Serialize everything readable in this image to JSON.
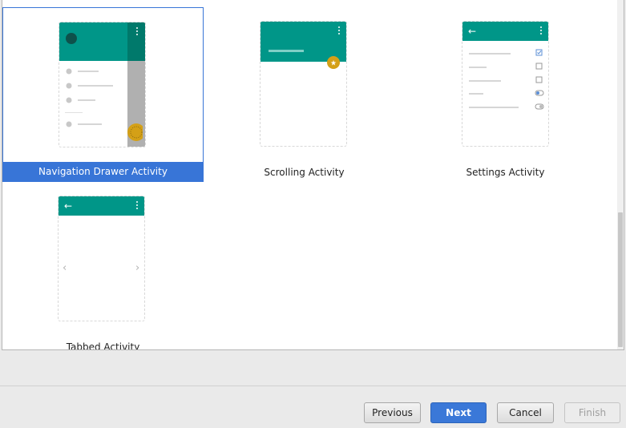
{
  "gallery": {
    "templates": [
      {
        "label": "Navigation Drawer Activity",
        "selected": true
      },
      {
        "label": "Scrolling Activity",
        "selected": false
      },
      {
        "label": "Settings Activity",
        "selected": false
      },
      {
        "label": "Tabbed Activity",
        "selected": false
      }
    ]
  },
  "buttons": {
    "previous": "Previous",
    "next": "Next",
    "cancel": "Cancel",
    "finish": "Finish"
  },
  "colors": {
    "teal": "#009688",
    "accent": "#d4a017",
    "selection": "#3875d7"
  },
  "icons": {
    "back": "back-arrow-icon",
    "overflow": "kebab-menu-icon",
    "fab": "star-icon",
    "prev_page": "chevron-left-icon",
    "next_page": "chevron-right-icon"
  }
}
